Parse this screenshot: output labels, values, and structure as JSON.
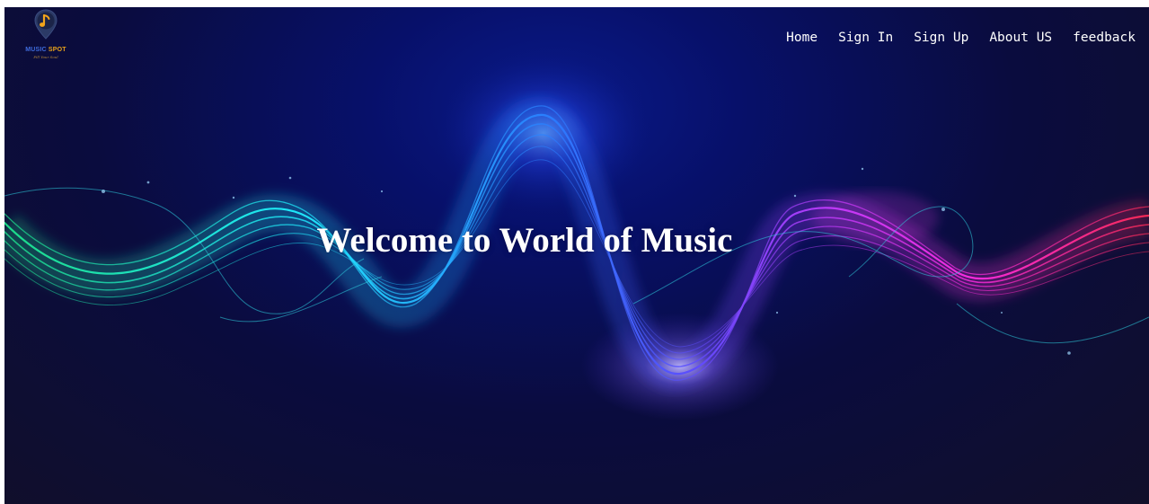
{
  "brand": {
    "word1": "MUSIC",
    "word2": "SPOT",
    "tagline": "Fill Your Soul",
    "icon": "music-note-pin-icon"
  },
  "nav": {
    "items": [
      {
        "label": "Home"
      },
      {
        "label": "Sign In"
      },
      {
        "label": "Sign Up"
      },
      {
        "label": "About US"
      },
      {
        "label": "feedback"
      }
    ]
  },
  "hero": {
    "headline": "Welcome to World of Music",
    "art": "sound-wave-illustration"
  },
  "colors": {
    "background": "#0a0c3e",
    "wave_green": "#1de38a",
    "wave_cyan": "#1ff0ff",
    "wave_blue": "#2a5cff",
    "wave_purple": "#8a3bff",
    "wave_magenta": "#ff2be0",
    "wave_red": "#ff2a55",
    "text": "#ffffff"
  }
}
